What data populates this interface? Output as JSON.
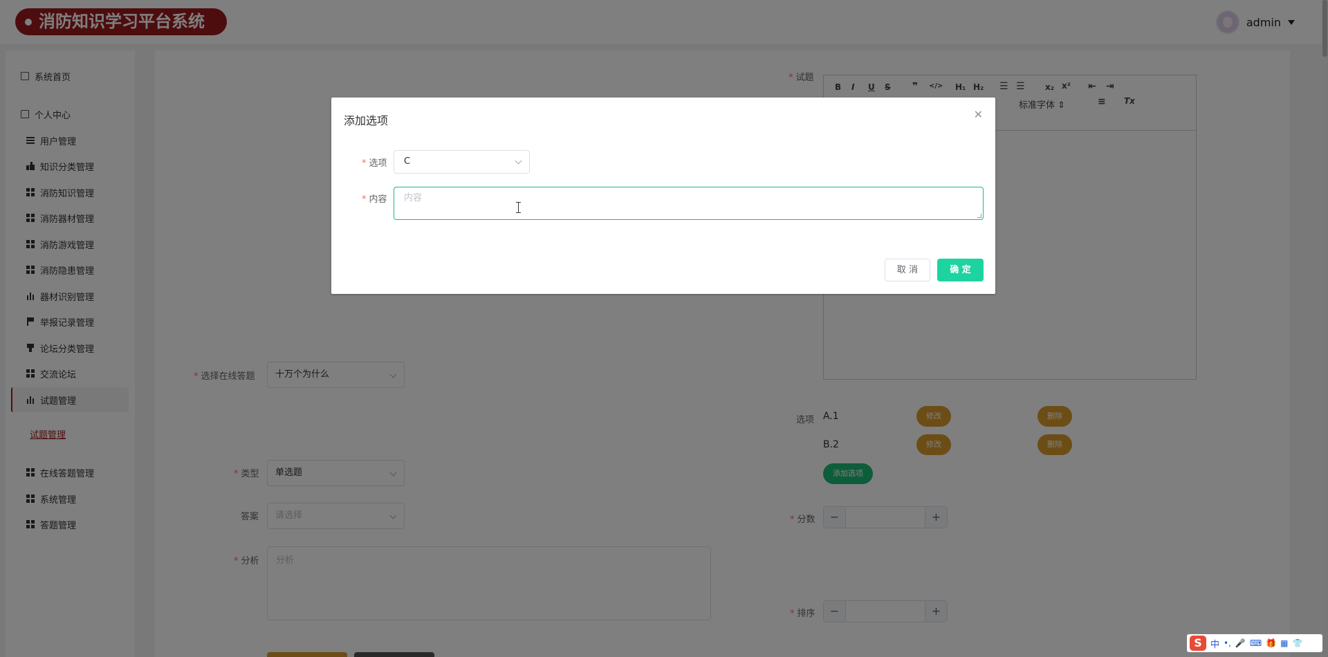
{
  "header": {
    "app_title": "消防知识学习平台系统",
    "user_name": "admin"
  },
  "sidebar": {
    "items": [
      {
        "label": "系统首页",
        "icon": "home-icon"
      },
      {
        "label": "个人中心",
        "icon": "profile-icon"
      },
      {
        "label": "用户管理",
        "icon": "list-icon"
      },
      {
        "label": "知识分类管理",
        "icon": "thumb-icon"
      },
      {
        "label": "消防知识管理",
        "icon": "grid-icon"
      },
      {
        "label": "消防器材管理",
        "icon": "grid-icon"
      },
      {
        "label": "消防游戏管理",
        "icon": "grid-icon"
      },
      {
        "label": "消防隐患管理",
        "icon": "grid-icon"
      },
      {
        "label": "器材识别管理",
        "icon": "bars-icon"
      },
      {
        "label": "举报记录管理",
        "icon": "flag-icon"
      },
      {
        "label": "论坛分类管理",
        "icon": "cup-icon"
      },
      {
        "label": "交流论坛",
        "icon": "grid-icon"
      },
      {
        "label": "试题管理",
        "icon": "bars-icon"
      },
      {
        "label": "在线答题管理",
        "icon": "grid-icon"
      },
      {
        "label": "系统管理",
        "icon": "grid-icon"
      },
      {
        "label": "答题管理",
        "icon": "grid-icon"
      }
    ],
    "sub_item": "试题管理"
  },
  "form": {
    "question_label": "试题",
    "editor_font": "标准字体",
    "online_quiz_label": "选择在线答题",
    "online_quiz_value": "十万个为什么",
    "type_label": "类型",
    "type_value": "单选题",
    "answer_label": "答案",
    "answer_placeholder": "请选择",
    "analysis_label": "分析",
    "analysis_placeholder": "分析",
    "options_label": "选项",
    "options": [
      {
        "text": "A.1",
        "edit": "修改",
        "delete": "删除"
      },
      {
        "text": "B.2",
        "edit": "修改",
        "delete": "删除"
      }
    ],
    "add_option": "添加选项",
    "score_label": "分数",
    "sort_label": "排序"
  },
  "dialog": {
    "title": "添加选项",
    "option_label": "选项",
    "option_value": "C",
    "content_label": "内容",
    "content_placeholder": "内容",
    "cancel": "取 消",
    "confirm": "确 定"
  },
  "ime": {
    "mode": "中"
  },
  "colors": {
    "brand": "#9b1b1e",
    "confirm": "#1dd3a0",
    "pill_orange": "#d99a2b",
    "pill_green": "#1dba74"
  }
}
